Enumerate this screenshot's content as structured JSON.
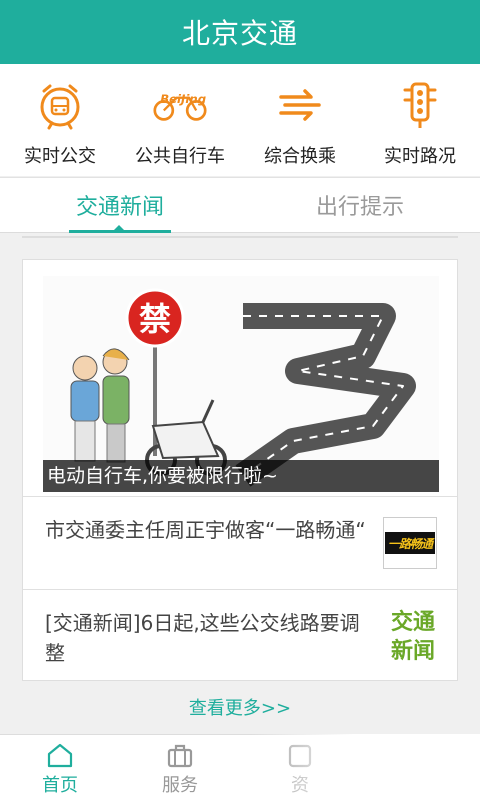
{
  "app": {
    "title": "北京交通"
  },
  "colors": {
    "accent": "#1fae9d",
    "icon_orange": "#f08a1c",
    "tag_green": "#6aa828"
  },
  "quick_actions": [
    {
      "label": "实时公交",
      "icon": "bus-clock-icon"
    },
    {
      "label": "公共自行车",
      "icon": "bicycle-icon"
    },
    {
      "label": "综合换乘",
      "icon": "transfer-icon"
    },
    {
      "label": "实时路况",
      "icon": "traffic-light-icon"
    }
  ],
  "tabs": [
    {
      "label": "交通新闻",
      "active": true
    },
    {
      "label": "出行提示",
      "active": false
    }
  ],
  "hero": {
    "caption": "电动自行车,你要被限行啦~",
    "sign_text": "禁",
    "icon": "restriction-illustration"
  },
  "news": [
    {
      "title": "市交通委主任周正宇做客“一路畅通“",
      "thumb_text": "一路畅通"
    },
    {
      "title": "[交通新闻]6日起,这些公交线路要调整",
      "tag": "交通新闻"
    }
  ],
  "more_link": "查看更多>>",
  "bottom_nav": [
    {
      "label": "首页",
      "icon": "home-icon",
      "active": true
    },
    {
      "label": "服务",
      "icon": "briefcase-icon",
      "active": false
    },
    {
      "label": "资",
      "icon": "info-icon",
      "active": false
    }
  ]
}
